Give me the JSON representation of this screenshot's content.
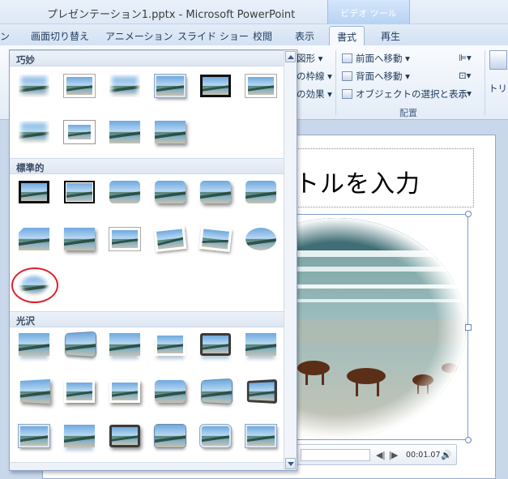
{
  "window": {
    "title": "プレゼンテーション1.pptx - Microsoft PowerPoint",
    "context_tab_group": "ビデオ ツール"
  },
  "tabs": [
    {
      "label": "ン"
    },
    {
      "label": "画面切り替え"
    },
    {
      "label": "アニメーション"
    },
    {
      "label": "スライド ショー"
    },
    {
      "label": "校閲"
    },
    {
      "label": "表示"
    },
    {
      "label": "書式",
      "active": true
    },
    {
      "label": "再生"
    }
  ],
  "ribbon": {
    "shape_border": "の枠線",
    "shape_label": "図形",
    "effects": "の効果",
    "bring_forward": "前面へ移動",
    "send_backward": "背面へ移動",
    "selection_pane": "オブジェクトの選択と表示",
    "arrange_group": "配置",
    "trim": "トリミ"
  },
  "gallery": {
    "sections": [
      {
        "label": "巧妙"
      },
      {
        "label": "標準的"
      },
      {
        "label": "光沢"
      }
    ]
  },
  "slide": {
    "title_placeholder": "トルを入力"
  },
  "player": {
    "time": "00:01.07"
  },
  "colors": {
    "highlight_ring": "#d9232e",
    "ribbon_accent": "#1e395b"
  }
}
